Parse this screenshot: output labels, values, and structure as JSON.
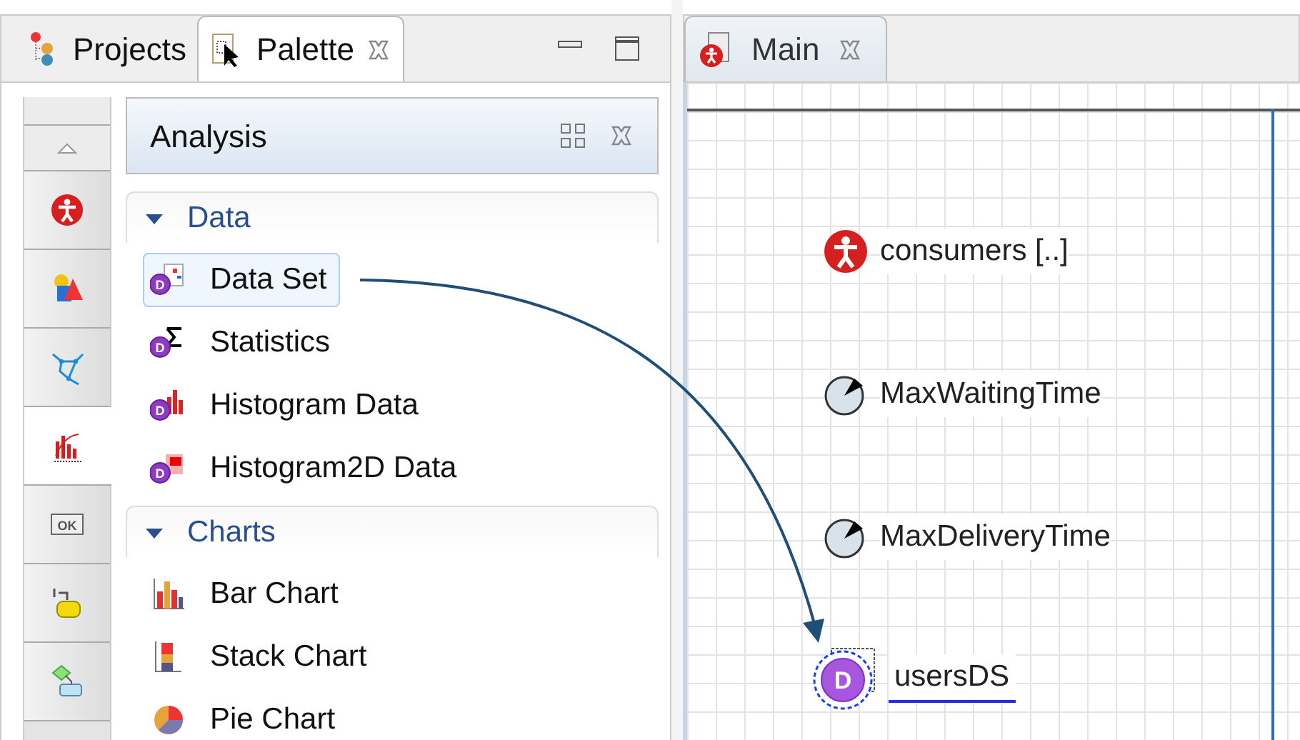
{
  "left_tabs": [
    {
      "label": "Projects",
      "kind": "projects",
      "selected": false,
      "closable": false
    },
    {
      "label": "Palette",
      "kind": "palette",
      "selected": true,
      "closable": true
    }
  ],
  "palette_categories": [
    {
      "kind": "agent",
      "selected": false
    },
    {
      "kind": "presentation",
      "selected": false
    },
    {
      "kind": "statechart",
      "selected": false
    },
    {
      "kind": "analysis",
      "selected": true
    },
    {
      "kind": "controls",
      "selected": false,
      "icon_text": "OK"
    },
    {
      "kind": "process",
      "selected": false
    },
    {
      "kind": "flow",
      "selected": false
    }
  ],
  "section": {
    "title": "Analysis"
  },
  "groups": [
    {
      "title": "Data",
      "expanded": true,
      "items": [
        {
          "label": "Data Set",
          "kind": "dataset",
          "selected": true,
          "badge": "D"
        },
        {
          "label": "Statistics",
          "kind": "statistics",
          "selected": false,
          "badge": "D"
        },
        {
          "label": "Histogram Data",
          "kind": "histogram",
          "selected": false,
          "badge": "D"
        },
        {
          "label": "Histogram2D Data",
          "kind": "histogram2d",
          "selected": false,
          "badge": "D"
        }
      ]
    },
    {
      "title": "Charts",
      "expanded": true,
      "items": [
        {
          "label": "Bar Chart",
          "kind": "bar",
          "selected": false
        },
        {
          "label": "Stack Chart",
          "kind": "stack",
          "selected": false
        },
        {
          "label": "Pie Chart",
          "kind": "pie",
          "selected": false
        }
      ]
    }
  ],
  "editor_tabs": [
    {
      "label": "Main",
      "selected": true,
      "closable": true
    }
  ],
  "canvas": {
    "elements": [
      {
        "label": "consumers [..]",
        "kind": "population",
        "selected": false
      },
      {
        "label": "MaxWaitingTime",
        "kind": "parameter",
        "selected": false
      },
      {
        "label": "MaxDeliveryTime",
        "kind": "parameter",
        "selected": false
      },
      {
        "label": "usersDS",
        "kind": "dataset",
        "selected": true,
        "badge": "D"
      }
    ]
  }
}
